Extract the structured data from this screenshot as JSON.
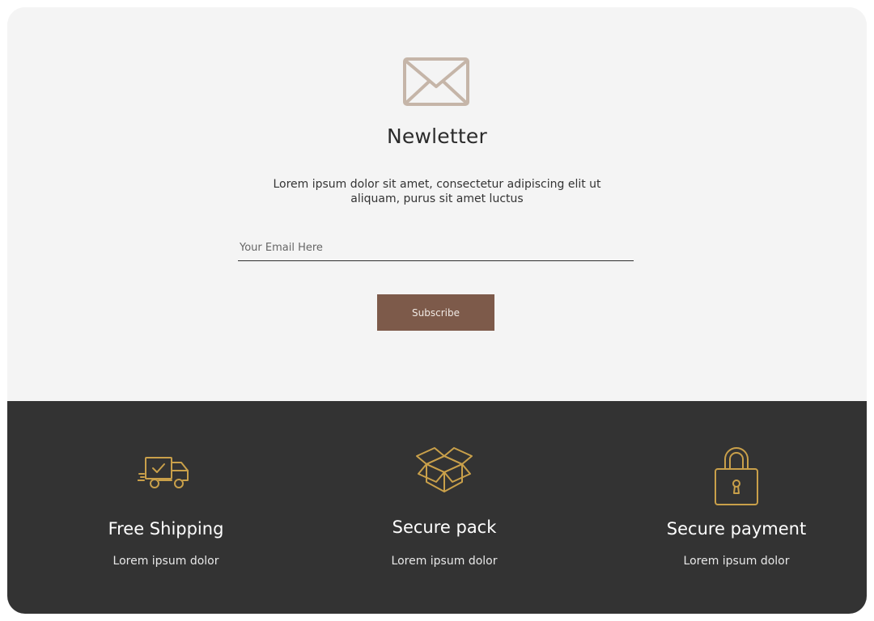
{
  "newsletter": {
    "title": "Newletter",
    "description": "Lorem ipsum dolor sit amet, consectetur adipiscing elit ut aliquam, purus sit amet luctus",
    "email_placeholder": "Your Email Here",
    "subscribe_label": "Subscribe",
    "icon": "envelope-icon"
  },
  "features": [
    {
      "icon": "truck-icon",
      "title": "Free Shipping",
      "subtitle": "Lorem ipsum dolor"
    },
    {
      "icon": "box-icon",
      "title": "Secure pack",
      "subtitle": "Lorem ipsum dolor"
    },
    {
      "icon": "lock-icon",
      "title": "Secure payment",
      "subtitle": "Lorem ipsum dolor"
    }
  ],
  "colors": {
    "background_light": "#f4f4f4",
    "background_dark": "#333333",
    "button": "#7d5a4a",
    "icon_gold": "#c9a04a",
    "envelope": "#c5b5a8"
  }
}
